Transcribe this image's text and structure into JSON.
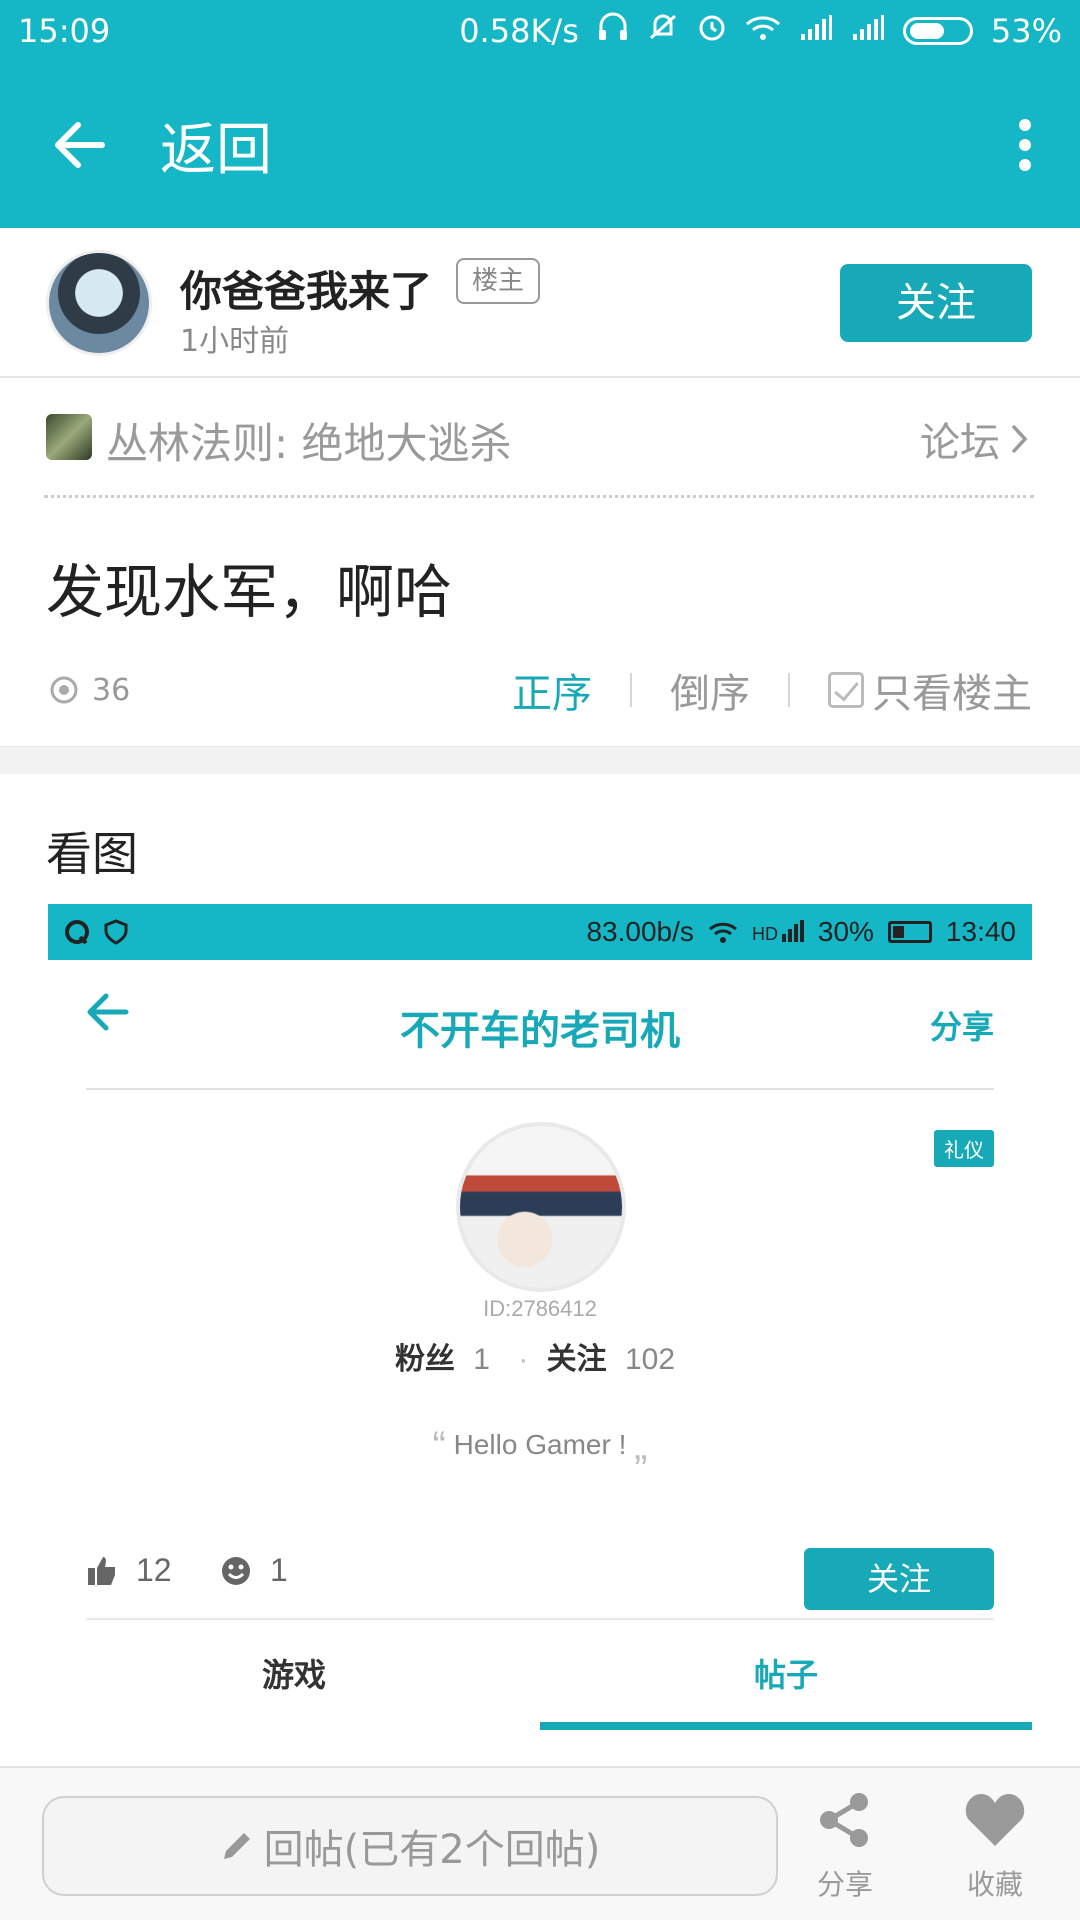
{
  "status_bar": {
    "time": "15:09",
    "net_speed": "0.58K/s",
    "battery": "53%",
    "battery_level": 0.53
  },
  "app_bar": {
    "title": "返回",
    "back_icon": "arrow-left-icon",
    "more_icon": "more-vert-icon"
  },
  "author": {
    "name": "你爸爸我来了",
    "tag": "楼主",
    "time": "1小时前",
    "follow_label": "关注"
  },
  "forum": {
    "name": "丛林法则: 绝地大逃杀",
    "link_label": "论坛"
  },
  "post": {
    "title": "发现水军，啊哈",
    "views": "36",
    "sort_options": [
      "正序",
      "倒序"
    ],
    "active_sort": "正序",
    "only_owner_label": "只看楼主"
  },
  "body": {
    "section_label": "看图",
    "screenshot": {
      "status_bar": {
        "net_speed": "83.00b/s",
        "battery": "30%",
        "time": "13:40",
        "battery_level": 0.3
      },
      "title": "不开车的老司机",
      "share_label": "分享",
      "badge": "礼仪",
      "user_id": "ID:2786412",
      "fans_label": "粉丝",
      "fans_count": "1",
      "following_label": "关注",
      "following_count": "102",
      "motto": "Hello Gamer !",
      "likes": "12",
      "smiles": "1",
      "follow_label": "关注",
      "tabs": [
        "游戏",
        "帖子"
      ],
      "active_tab": "帖子"
    }
  },
  "bottom_bar": {
    "reply_placeholder": "回帖(已有2个回帖)",
    "share_label": "分享",
    "favorite_label": "收藏"
  },
  "colors": {
    "accent": "#15b6c6",
    "button": "#17a9b7"
  }
}
